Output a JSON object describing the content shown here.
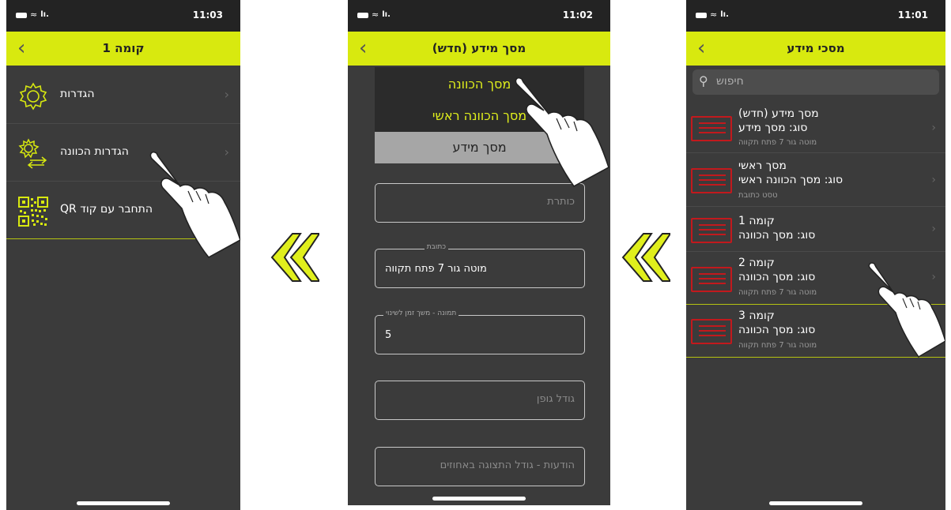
{
  "colors": {
    "accent": "#d8e90f",
    "background": "#3b3b3b",
    "icon_red": "#c2191d",
    "accent_text": "#e0ef1c"
  },
  "phone1": {
    "time": "11:03",
    "title": "קומה 1",
    "items": [
      {
        "label": "הגדרות",
        "icon": "gear-icon"
      },
      {
        "label": "הגדרות הכוונה",
        "icon": "gear-arrows-icon"
      },
      {
        "label": "התחבר עם קוד QR",
        "icon": "qr-code-icon"
      }
    ]
  },
  "phone2": {
    "time": "11:02",
    "title": "מסך מידע (חדש)",
    "dropdown_options": [
      "מסך הכוונה",
      "מסך הכוונה ראשי",
      "מסך מידע"
    ],
    "fields": [
      {
        "placeholder": "כותרת",
        "label": "",
        "value": ""
      },
      {
        "placeholder": "",
        "label": "כתובת",
        "value": "מוטה גור 7 פתח תקווה"
      },
      {
        "placeholder": "",
        "label": "תמונה - משך זמן לשינוי",
        "value": "5"
      },
      {
        "placeholder": "גודל גופן",
        "label": "",
        "value": ""
      },
      {
        "placeholder": "הודעות - גודל התצוגה באחוזים",
        "label": "",
        "value": ""
      }
    ]
  },
  "phone3": {
    "time": "11:01",
    "title": "מסכי מידע",
    "search_placeholder": "חיפוש",
    "rows": [
      {
        "title": "מסך מידע (חדש)",
        "type": "סוג: מסך מידע",
        "address": "מוטה גור 7 פתח תקווה"
      },
      {
        "title": "מסך ראשי",
        "type": "סוג: מסך הכוונה ראשי",
        "address": "טסט כתובת"
      },
      {
        "title": "קומה 1",
        "type": "סוג: מסך הכוונה",
        "address": ""
      },
      {
        "title": "קומה 2",
        "type": "סוג: מסך הכוונה",
        "address": "מוטה גור 7 פתח תקווה"
      },
      {
        "title": "קומה 3",
        "type": "סוג: מסך הכוונה",
        "address": "מוטה גור 7 פתח תקווה"
      }
    ]
  }
}
